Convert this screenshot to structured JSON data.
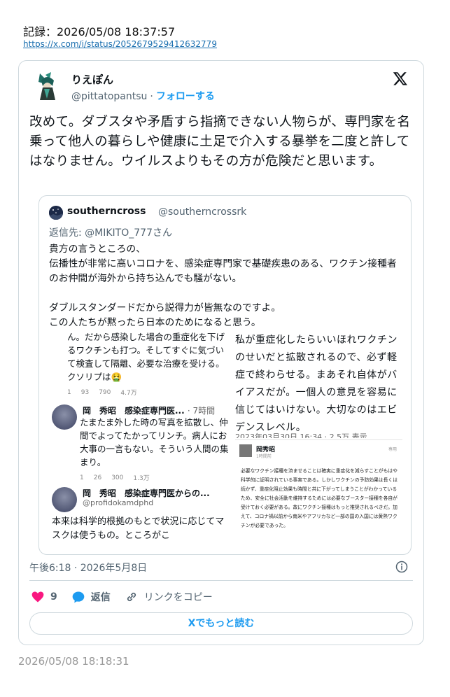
{
  "record": {
    "label": "記録：2026/05/08 18:37:57",
    "url": "https://x.com/i/status/2052679529412632779"
  },
  "tweet": {
    "author_name": "りえぽん",
    "author_handle": "@pittatopantsu",
    "follow_label": "フォローする",
    "text": "改めて。ダブスタや矛盾すら指摘できない人物らが、専門家を名乗って他人の暮らしや健康に土足で介入する暴挙を二度と許してはなりません。ウイルスよりもその方が危険だと思います。",
    "timestamp": "午後6:18 · 2026年5月8日",
    "like_count": "9",
    "reply_label": "返信",
    "copy_link_label": "リンクをコピー",
    "read_more_label": "Xでもっと読む"
  },
  "quote": {
    "author_name": "southerncross",
    "author_handle": "@southerncrossrk",
    "reply_to": "返信先: @MIKITO_777さん",
    "text": "貴方の言うところの、\n伝播性が非常に高いコロナを、感染症専門家で基礎疾患のある、ワクチン接種者のお仲間が海外から持ち込んでも騒がない。\n\nダブルスタンダードだから説得力が皆無なのですよ。\nこの人たちが黙ったら日本のためになると思う。"
  },
  "screenshot_left": {
    "top_text": "ん。だから感染した場合の重症化を下げるワクチンも打つ。そしてすぐに気づいて検査して隔離、必要な治療を受ける。クソリプは🤮",
    "top_metrics": [
      "1",
      "93",
      "790",
      "4.7万"
    ],
    "post2_name": "岡　秀昭　感染症専門医...",
    "post2_time": "· 7時間",
    "post2_text": "たまたま外した時の写真を拡散し、仲間でよってたかってリンチ。病人にお大事の一言もない。そういう人間の集まり。",
    "post2_metrics": [
      "1",
      "26",
      "300",
      "1.3万"
    ],
    "post3_name": "岡　秀昭　感染症専門医からの...",
    "post3_handle": "@profidokamdphd",
    "post3_text": "本来は科学的根拠のもとで状況に応じてマスクは使うもの。ところがこ"
  },
  "screenshot_right_top": {
    "text": "私が重症化したらいいほれワクチンのせいだと拡散されるので、必ず軽症で終わらせる。まあそれ自体がバイアスだが。一個人の意見を容易に信じてはいけない。大切なのはエビデンスレベル。",
    "date": "2023年03月30日 16:34 · 2.5万 表示"
  },
  "screenshot_right_bottom": {
    "name": "岡秀昭",
    "time": "1時間前",
    "extra": "専用",
    "text": "必要なワクチン接種を済ませることは確実に重症化を減らすことがもはや科学的に証明されている事実である。しかしワクチンの予防効果は長くは続かず、重症化阻止効果も時間と共に下がってしまうことがわかっているため、安全に社会活動を維持するためには必要なブースター接種を各自が受けておく必要がある。故にワクチン接種はもっと推奨されるべきだ。加えて、コロナ禍以前から南米やアフリカなど一部の国の入国には黄熱ワクチンが必要であった。"
  },
  "footer": {
    "timestamp": "2026/05/08 18:18:31"
  },
  "colors": {
    "accent": "#1d9bf0",
    "like": "#f91880",
    "muted": "#536471",
    "border": "#cfd9de"
  }
}
